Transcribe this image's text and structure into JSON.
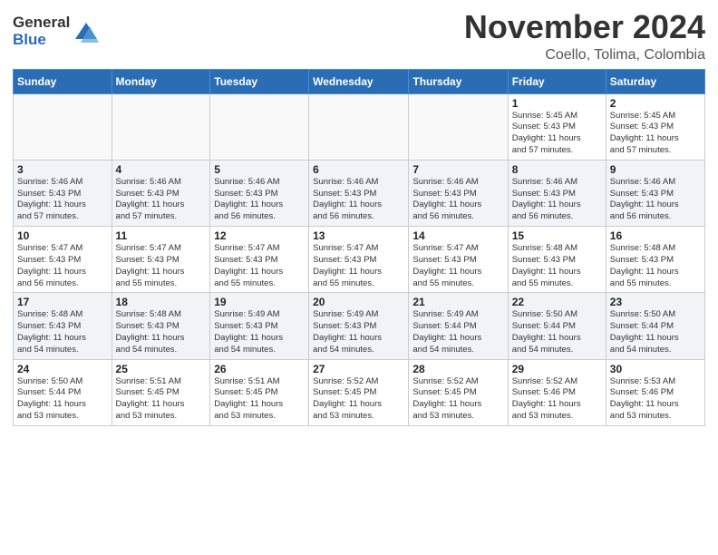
{
  "header": {
    "logo_general": "General",
    "logo_blue": "Blue",
    "month_title": "November 2024",
    "location": "Coello, Tolima, Colombia"
  },
  "weekdays": [
    "Sunday",
    "Monday",
    "Tuesday",
    "Wednesday",
    "Thursday",
    "Friday",
    "Saturday"
  ],
  "weeks": [
    [
      {
        "day": "",
        "info": ""
      },
      {
        "day": "",
        "info": ""
      },
      {
        "day": "",
        "info": ""
      },
      {
        "day": "",
        "info": ""
      },
      {
        "day": "",
        "info": ""
      },
      {
        "day": "1",
        "info": "Sunrise: 5:45 AM\nSunset: 5:43 PM\nDaylight: 11 hours\nand 57 minutes."
      },
      {
        "day": "2",
        "info": "Sunrise: 5:45 AM\nSunset: 5:43 PM\nDaylight: 11 hours\nand 57 minutes."
      }
    ],
    [
      {
        "day": "3",
        "info": "Sunrise: 5:46 AM\nSunset: 5:43 PM\nDaylight: 11 hours\nand 57 minutes."
      },
      {
        "day": "4",
        "info": "Sunrise: 5:46 AM\nSunset: 5:43 PM\nDaylight: 11 hours\nand 57 minutes."
      },
      {
        "day": "5",
        "info": "Sunrise: 5:46 AM\nSunset: 5:43 PM\nDaylight: 11 hours\nand 56 minutes."
      },
      {
        "day": "6",
        "info": "Sunrise: 5:46 AM\nSunset: 5:43 PM\nDaylight: 11 hours\nand 56 minutes."
      },
      {
        "day": "7",
        "info": "Sunrise: 5:46 AM\nSunset: 5:43 PM\nDaylight: 11 hours\nand 56 minutes."
      },
      {
        "day": "8",
        "info": "Sunrise: 5:46 AM\nSunset: 5:43 PM\nDaylight: 11 hours\nand 56 minutes."
      },
      {
        "day": "9",
        "info": "Sunrise: 5:46 AM\nSunset: 5:43 PM\nDaylight: 11 hours\nand 56 minutes."
      }
    ],
    [
      {
        "day": "10",
        "info": "Sunrise: 5:47 AM\nSunset: 5:43 PM\nDaylight: 11 hours\nand 56 minutes."
      },
      {
        "day": "11",
        "info": "Sunrise: 5:47 AM\nSunset: 5:43 PM\nDaylight: 11 hours\nand 55 minutes."
      },
      {
        "day": "12",
        "info": "Sunrise: 5:47 AM\nSunset: 5:43 PM\nDaylight: 11 hours\nand 55 minutes."
      },
      {
        "day": "13",
        "info": "Sunrise: 5:47 AM\nSunset: 5:43 PM\nDaylight: 11 hours\nand 55 minutes."
      },
      {
        "day": "14",
        "info": "Sunrise: 5:47 AM\nSunset: 5:43 PM\nDaylight: 11 hours\nand 55 minutes."
      },
      {
        "day": "15",
        "info": "Sunrise: 5:48 AM\nSunset: 5:43 PM\nDaylight: 11 hours\nand 55 minutes."
      },
      {
        "day": "16",
        "info": "Sunrise: 5:48 AM\nSunset: 5:43 PM\nDaylight: 11 hours\nand 55 minutes."
      }
    ],
    [
      {
        "day": "17",
        "info": "Sunrise: 5:48 AM\nSunset: 5:43 PM\nDaylight: 11 hours\nand 54 minutes."
      },
      {
        "day": "18",
        "info": "Sunrise: 5:48 AM\nSunset: 5:43 PM\nDaylight: 11 hours\nand 54 minutes."
      },
      {
        "day": "19",
        "info": "Sunrise: 5:49 AM\nSunset: 5:43 PM\nDaylight: 11 hours\nand 54 minutes."
      },
      {
        "day": "20",
        "info": "Sunrise: 5:49 AM\nSunset: 5:43 PM\nDaylight: 11 hours\nand 54 minutes."
      },
      {
        "day": "21",
        "info": "Sunrise: 5:49 AM\nSunset: 5:44 PM\nDaylight: 11 hours\nand 54 minutes."
      },
      {
        "day": "22",
        "info": "Sunrise: 5:50 AM\nSunset: 5:44 PM\nDaylight: 11 hours\nand 54 minutes."
      },
      {
        "day": "23",
        "info": "Sunrise: 5:50 AM\nSunset: 5:44 PM\nDaylight: 11 hours\nand 54 minutes."
      }
    ],
    [
      {
        "day": "24",
        "info": "Sunrise: 5:50 AM\nSunset: 5:44 PM\nDaylight: 11 hours\nand 53 minutes."
      },
      {
        "day": "25",
        "info": "Sunrise: 5:51 AM\nSunset: 5:45 PM\nDaylight: 11 hours\nand 53 minutes."
      },
      {
        "day": "26",
        "info": "Sunrise: 5:51 AM\nSunset: 5:45 PM\nDaylight: 11 hours\nand 53 minutes."
      },
      {
        "day": "27",
        "info": "Sunrise: 5:52 AM\nSunset: 5:45 PM\nDaylight: 11 hours\nand 53 minutes."
      },
      {
        "day": "28",
        "info": "Sunrise: 5:52 AM\nSunset: 5:45 PM\nDaylight: 11 hours\nand 53 minutes."
      },
      {
        "day": "29",
        "info": "Sunrise: 5:52 AM\nSunset: 5:46 PM\nDaylight: 11 hours\nand 53 minutes."
      },
      {
        "day": "30",
        "info": "Sunrise: 5:53 AM\nSunset: 5:46 PM\nDaylight: 11 hours\nand 53 minutes."
      }
    ]
  ]
}
